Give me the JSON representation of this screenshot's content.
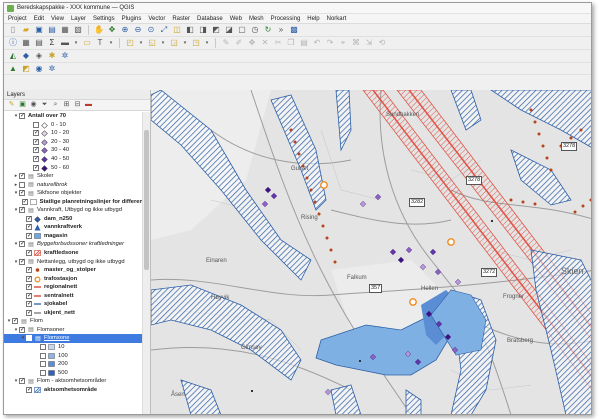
{
  "window": {
    "title": "Beredskapspakke - XXX kommune — QGIS"
  },
  "menu": [
    "Project",
    "Edit",
    "View",
    "Layer",
    "Settings",
    "Plugins",
    "Vector",
    "Raster",
    "Database",
    "Web",
    "Mesh",
    "Processing",
    "Help",
    "Norkart"
  ],
  "panel": {
    "title": "Layers"
  },
  "layers": [
    {
      "label": "Antall over 70",
      "indent": 1,
      "arrow": "▾",
      "checked": true,
      "style": "bold",
      "icon": "none"
    },
    {
      "label": "0 - 10",
      "indent": 3,
      "checked": false,
      "icon": "diamond",
      "color": "#ffffff"
    },
    {
      "label": "10 - 20",
      "indent": 3,
      "checked": true,
      "icon": "diamond",
      "color": "#e2d6ef"
    },
    {
      "label": "20 - 30",
      "indent": 3,
      "checked": true,
      "icon": "diamond",
      "color": "#b79bd9"
    },
    {
      "label": "30 - 40",
      "indent": 3,
      "checked": true,
      "icon": "diamond",
      "color": "#8d63c2"
    },
    {
      "label": "40 - 50",
      "indent": 3,
      "checked": true,
      "icon": "diamond",
      "color": "#6236a8"
    },
    {
      "label": "50 - 60",
      "indent": 3,
      "checked": true,
      "icon": "diamond",
      "color": "#3d127f"
    },
    {
      "label": "Skoler",
      "indent": 1,
      "arrow": "▸",
      "checked": true,
      "icon": "group"
    },
    {
      "label": "naturellbrok",
      "indent": 1,
      "arrow": "▸",
      "checked": false,
      "style": "italic",
      "icon": "group"
    },
    {
      "label": "Sikfsone objekter",
      "indent": 1,
      "arrow": "▾",
      "checked": true,
      "icon": "group"
    },
    {
      "label": "Statlige planretningslinjer for differen",
      "indent": 2,
      "checked": true,
      "style": "bold",
      "icon": "fill",
      "color": "#ffffff"
    },
    {
      "label": "Vannkraft, Utbygd og ikke utbygd",
      "indent": 1,
      "arrow": "▾",
      "checked": true,
      "icon": "group"
    },
    {
      "label": "dam_n250",
      "indent": 2,
      "checked": true,
      "style": "bold",
      "icon": "diamond",
      "color": "#2d5fa8"
    },
    {
      "label": "vannkraftverk",
      "indent": 2,
      "checked": true,
      "style": "bold",
      "icon": "triangle",
      "color": "#2d5fa8"
    },
    {
      "label": "magasin",
      "indent": 2,
      "checked": true,
      "style": "bold",
      "icon": "fill",
      "color": "#6fa7e6"
    },
    {
      "label": "Byggeforbudssoner kraftledninger",
      "indent": 1,
      "arrow": "▾",
      "checked": true,
      "style": "italic",
      "icon": "group"
    },
    {
      "label": "kraftledsone",
      "indent": 2,
      "checked": true,
      "style": "bold",
      "icon": "hatch",
      "color": "#d13b2a"
    },
    {
      "label": "Nettanlegg, utbygd og ikke utbygd",
      "indent": 1,
      "arrow": "▾",
      "checked": true,
      "icon": "group"
    },
    {
      "label": "master_og_stolper",
      "indent": 2,
      "checked": true,
      "style": "bold",
      "icon": "dot",
      "color": "#b5441c"
    },
    {
      "label": "trafostasjon",
      "indent": 2,
      "checked": true,
      "style": "bold",
      "icon": "ring",
      "color": "#f08a1c"
    },
    {
      "label": "regionalnett",
      "indent": 2,
      "checked": true,
      "style": "bold",
      "icon": "line",
      "color": "#d13b2a"
    },
    {
      "label": "sentralnett",
      "indent": 2,
      "checked": true,
      "style": "bold",
      "icon": "line",
      "color": "#d13b2a"
    },
    {
      "label": "sjokabel",
      "indent": 2,
      "checked": true,
      "style": "bold",
      "icon": "line",
      "color": "#2d5fa8"
    },
    {
      "label": "ukjent_nett",
      "indent": 2,
      "checked": true,
      "style": "bold",
      "icon": "line",
      "color": "#777777"
    },
    {
      "label": "Flom",
      "indent": 0,
      "arrow": "▾",
      "checked": true,
      "icon": "group"
    },
    {
      "label": "Flomsoner",
      "indent": 1,
      "arrow": "▾",
      "checked": true,
      "icon": "group"
    },
    {
      "label": "Flomsone",
      "indent": 2,
      "arrow": "▾",
      "checked": true,
      "style": "underline",
      "icon": "group",
      "selected": true
    },
    {
      "label": "10",
      "indent": 4,
      "checked": false,
      "icon": "fill",
      "color": "#c6d9f2"
    },
    {
      "label": "100",
      "indent": 4,
      "checked": false,
      "icon": "fill",
      "color": "#8fb5e6"
    },
    {
      "label": "200",
      "indent": 4,
      "checked": false,
      "icon": "fill",
      "color": "#5b8dd4"
    },
    {
      "label": "500",
      "indent": 4,
      "checked": false,
      "icon": "fill",
      "color": "#2f62b8"
    },
    {
      "label": "Flom - aktsomhetsområder",
      "indent": 1,
      "arrow": "▾",
      "checked": true,
      "icon": "group"
    },
    {
      "label": "aktsomhetsområde",
      "indent": 2,
      "checked": true,
      "style": "bold",
      "icon": "hatch",
      "color": "#2d5fa8"
    }
  ],
  "map": {
    "labels": [
      {
        "id": "label-gulset",
        "text": "Gulset",
        "big": false
      },
      {
        "id": "label-einaren",
        "text": "Einaren",
        "big": false
      },
      {
        "id": "label-falkum",
        "text": "Falkum",
        "big": false
      },
      {
        "id": "label-skien",
        "text": "Skien",
        "big": true
      },
      {
        "id": "label-frogner",
        "text": "Frogner",
        "big": false
      },
      {
        "id": "label-bratsberg",
        "text": "Bratsberg",
        "big": false
      },
      {
        "id": "label-asen",
        "text": "Åsen",
        "big": false
      },
      {
        "id": "label-hoyvik",
        "text": "Høyvik",
        "big": false
      },
      {
        "id": "label-rising",
        "text": "Rising",
        "big": false
      },
      {
        "id": "label-gimso",
        "text": "Gimsøy",
        "big": false
      },
      {
        "id": "label-skotfoss",
        "text": "Sundbakken",
        "big": false
      },
      {
        "id": "label-hellen",
        "text": "Hellen",
        "big": false
      }
    ],
    "road_shields": [
      "3278",
      "3282",
      "357",
      "3272",
      "3278"
    ]
  },
  "colors": {
    "map_bg": "#e4e4e4",
    "hatch_blue": "#2d5fa8",
    "flood": "#7fb0e3",
    "flood_deep": "#5b8dd4",
    "red_zone": "#e0574a",
    "pylon": "#b5441c",
    "substation": "#f08a1c",
    "points": "#5a2a9a",
    "selection": "#3d7be0"
  }
}
